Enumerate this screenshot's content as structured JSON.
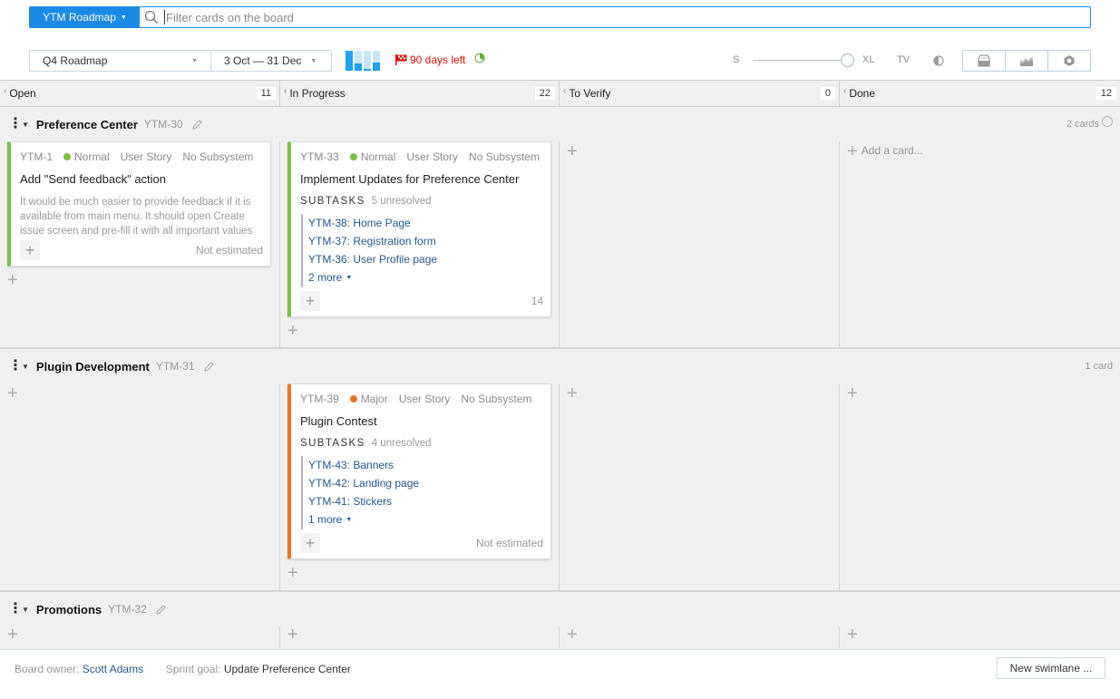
{
  "topbar": {
    "board_name": "YTM Roadmap",
    "search_placeholder": "Filter cards on the board",
    "search_value": ""
  },
  "toolbar": {
    "sprint": "Q4 Roadmap",
    "dates": "3 Oct — 31 Dec",
    "mini_chart_fill": [
      1.0,
      0.35,
      0.08,
      0.4
    ],
    "days_left": "90 days left",
    "size_min_label": "S",
    "size_max_label": "XL",
    "size_value": "XL",
    "tv_label": "TV",
    "colors": {
      "accent": "#1b8ae6",
      "days_left": "#e30d0d",
      "normal": "#7bc043",
      "major": "#f47321",
      "link": "#23588b"
    }
  },
  "columns": [
    {
      "name": "Open",
      "count": "11"
    },
    {
      "name": "In Progress",
      "count": "22"
    },
    {
      "name": "To Verify",
      "count": "0"
    },
    {
      "name": "Done",
      "count": "12"
    }
  ],
  "swimlanes": [
    {
      "title": "Preference Center",
      "id": "YTM-30",
      "cards_count": "2 cards",
      "open_card": {
        "id": "YTM-1",
        "priority": "Normal",
        "type": "User Story",
        "subsystem": "No Subsystem",
        "summary": "Add \"Send feedback\" action",
        "description": "It would be much easier to provide feedback if it is available from main menu. It should open Create issue screen and pre-fill it with all important values",
        "estimate": "Not estimated"
      },
      "progress_card": {
        "id": "YTM-33",
        "priority": "Normal",
        "type": "User Story",
        "subsystem": "No Subsystem",
        "summary": "Implement Updates for Preference Center",
        "subtasks_label": "SUBTASKS",
        "unresolved": "5 unresolved",
        "subtasks": [
          "YTM-38: Home Page",
          "YTM-37: Registration form",
          "YTM-36: User Profile page"
        ],
        "more": "2 more",
        "estimate": "14"
      },
      "done_add_label": "Add a card..."
    },
    {
      "title": "Plugin Development",
      "id": "YTM-31",
      "cards_count": "1 card",
      "progress_card": {
        "id": "YTM-39",
        "priority": "Major",
        "type": "User Story",
        "subsystem": "No Subsystem",
        "summary": "Plugin Contest",
        "subtasks_label": "SUBTASKS",
        "unresolved": "4 unresolved",
        "subtasks": [
          "YTM-43: Banners",
          "YTM-42: Landing page",
          "YTM-41: Stickers"
        ],
        "more": "1 more",
        "estimate": "Not estimated"
      }
    },
    {
      "title": "Promotions",
      "id": "YTM-32"
    }
  ],
  "footer": {
    "owner_label": "Board owner:",
    "owner": "Scott Adams",
    "goal_label": "Sprint goal:",
    "goal": "Update Preference Center",
    "new_swimlane": "New swimlane ..."
  }
}
